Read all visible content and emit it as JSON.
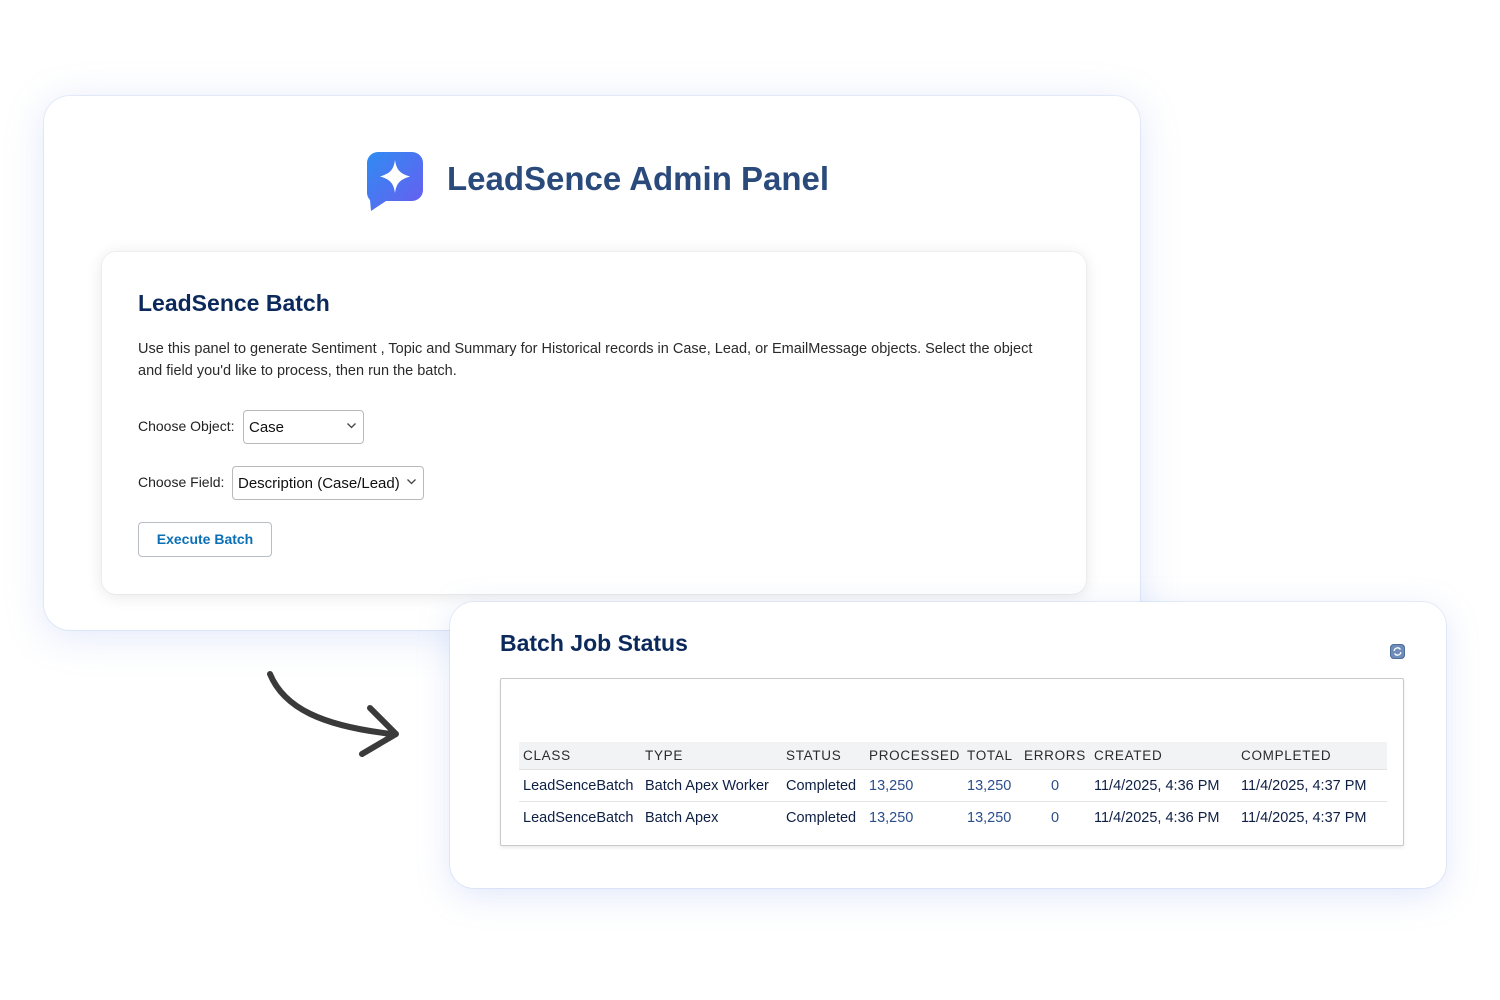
{
  "header": {
    "title": "LeadSence Admin Panel",
    "logo_icon": "sparkle-chat-icon",
    "logo_gradient": [
      "#2f8cf2",
      "#6a5cf0"
    ]
  },
  "batch": {
    "title": "LeadSence Batch",
    "description": "Use this panel to generate Sentiment , Topic and Summary for Historical records in Case, Lead, or EmailMessage objects. Select the object and field you'd like to process, then run the batch.",
    "object_label": "Choose Object:",
    "object_value": "Case",
    "field_label": "Choose Field:",
    "field_value": "Description (Case/Lead)",
    "execute_label": "Execute Batch"
  },
  "status": {
    "title": "Batch Job Status",
    "refresh_icon": "refresh-icon",
    "columns": [
      "CLASS",
      "TYPE",
      "STATUS",
      "PROCESSED",
      "TOTAL",
      "ERRORS",
      "CREATED",
      "COMPLETED"
    ],
    "rows": [
      {
        "class": "LeadSenceBatch",
        "type": "Batch Apex Worker",
        "status": "Completed",
        "processed": "13,250",
        "total": "13,250",
        "errors": "0",
        "created": "11/4/2025, 4:36 PM",
        "completed": "11/4/2025, 4:37 PM"
      },
      {
        "class": "LeadSenceBatch",
        "type": "Batch Apex",
        "status": "Completed",
        "processed": "13,250",
        "total": "13,250",
        "errors": "0",
        "created": "11/4/2025, 4:36 PM",
        "completed": "11/4/2025, 4:37 PM"
      }
    ]
  },
  "colors": {
    "heading": "#0b2a5b",
    "app_title": "#2b4a7c",
    "link_blue": "#0b6fb5",
    "arrow": "#3a3a3a"
  }
}
